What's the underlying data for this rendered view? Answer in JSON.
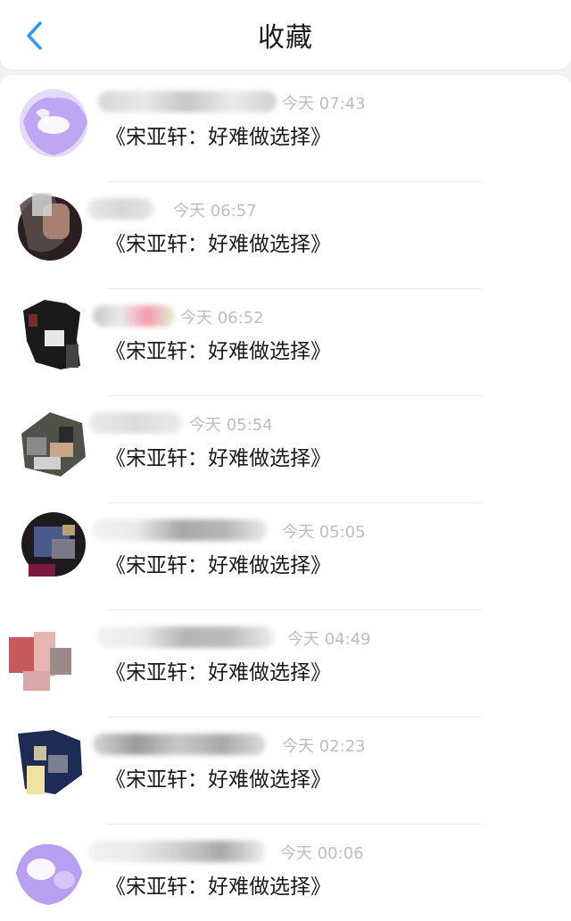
{
  "nav": {
    "back_icon": "chevron-left-icon",
    "title": "收藏",
    "accent_color": "#2f9bf0"
  },
  "items": [
    {
      "time": "今天 07:43",
      "message": "《宋亚轩：好难做选择》",
      "avatar_color": "#b99ef0"
    },
    {
      "time": "今天 06:57",
      "message": "《宋亚轩：好难做选择》",
      "avatar_color": "#3a2a2a"
    },
    {
      "time": "今天 06:52",
      "message": "《宋亚轩：好难做选择》",
      "avatar_color": "#1c1c1c"
    },
    {
      "time": "今天 05:54",
      "message": "《宋亚轩：好难做选择》",
      "avatar_color": "#6f7a6a"
    },
    {
      "time": "今天 05:05",
      "message": "《宋亚轩：好难做选择》",
      "avatar_color": "#3a4a78"
    },
    {
      "time": "今天 04:49",
      "message": "《宋亚轩：好难做选择》",
      "avatar_color": "#c87070"
    },
    {
      "time": "今天 02:23",
      "message": "《宋亚轩：好难做选择》",
      "avatar_color": "#1f2f58"
    },
    {
      "time": "今天 00:06",
      "message": "《宋亚轩：好难做选择》",
      "avatar_color": "#b89ff0"
    }
  ]
}
